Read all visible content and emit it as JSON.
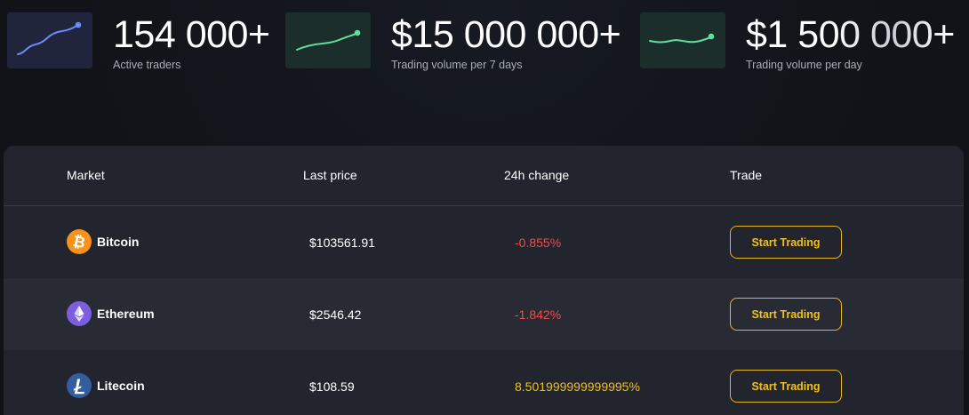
{
  "stats": [
    {
      "value": "154 000+",
      "label": "Active traders",
      "icon": "trend-line-icon",
      "color": "#6b8cff"
    },
    {
      "value": "$15 000 000+",
      "label": "Trading volume per 7 days",
      "icon": "trend-line-icon",
      "color": "#5fe0a0"
    },
    {
      "value": "$1 500 000+",
      "label": "Trading volume per day",
      "icon": "trend-line-icon",
      "color": "#5fe0a0"
    }
  ],
  "table": {
    "headers": {
      "market": "Market",
      "last_price": "Last price",
      "change": "24h change",
      "trade": "Trade"
    },
    "rows": [
      {
        "name": "Bitcoin",
        "icon": "bitcoin-icon",
        "icon_color": "#f7931a",
        "price": "$103561.91",
        "change": "-0.855%",
        "change_color": "#ef4c4c",
        "button": "Start Trading"
      },
      {
        "name": "Ethereum",
        "icon": "ethereum-icon",
        "icon_color": "#7b5fe0",
        "price": "$2546.42",
        "change": "-1.842%",
        "change_color": "#ef4c4c",
        "button": "Start Trading"
      },
      {
        "name": "Litecoin",
        "icon": "litecoin-icon",
        "icon_color": "#345d9d",
        "price": "$108.59",
        "change": "8.501999999999995%",
        "change_color": "#f0c020",
        "button": "Start Trading"
      }
    ]
  },
  "colors": {
    "accent": "#f0c020",
    "negative": "#ef4c4c",
    "panel": "#22252d"
  }
}
